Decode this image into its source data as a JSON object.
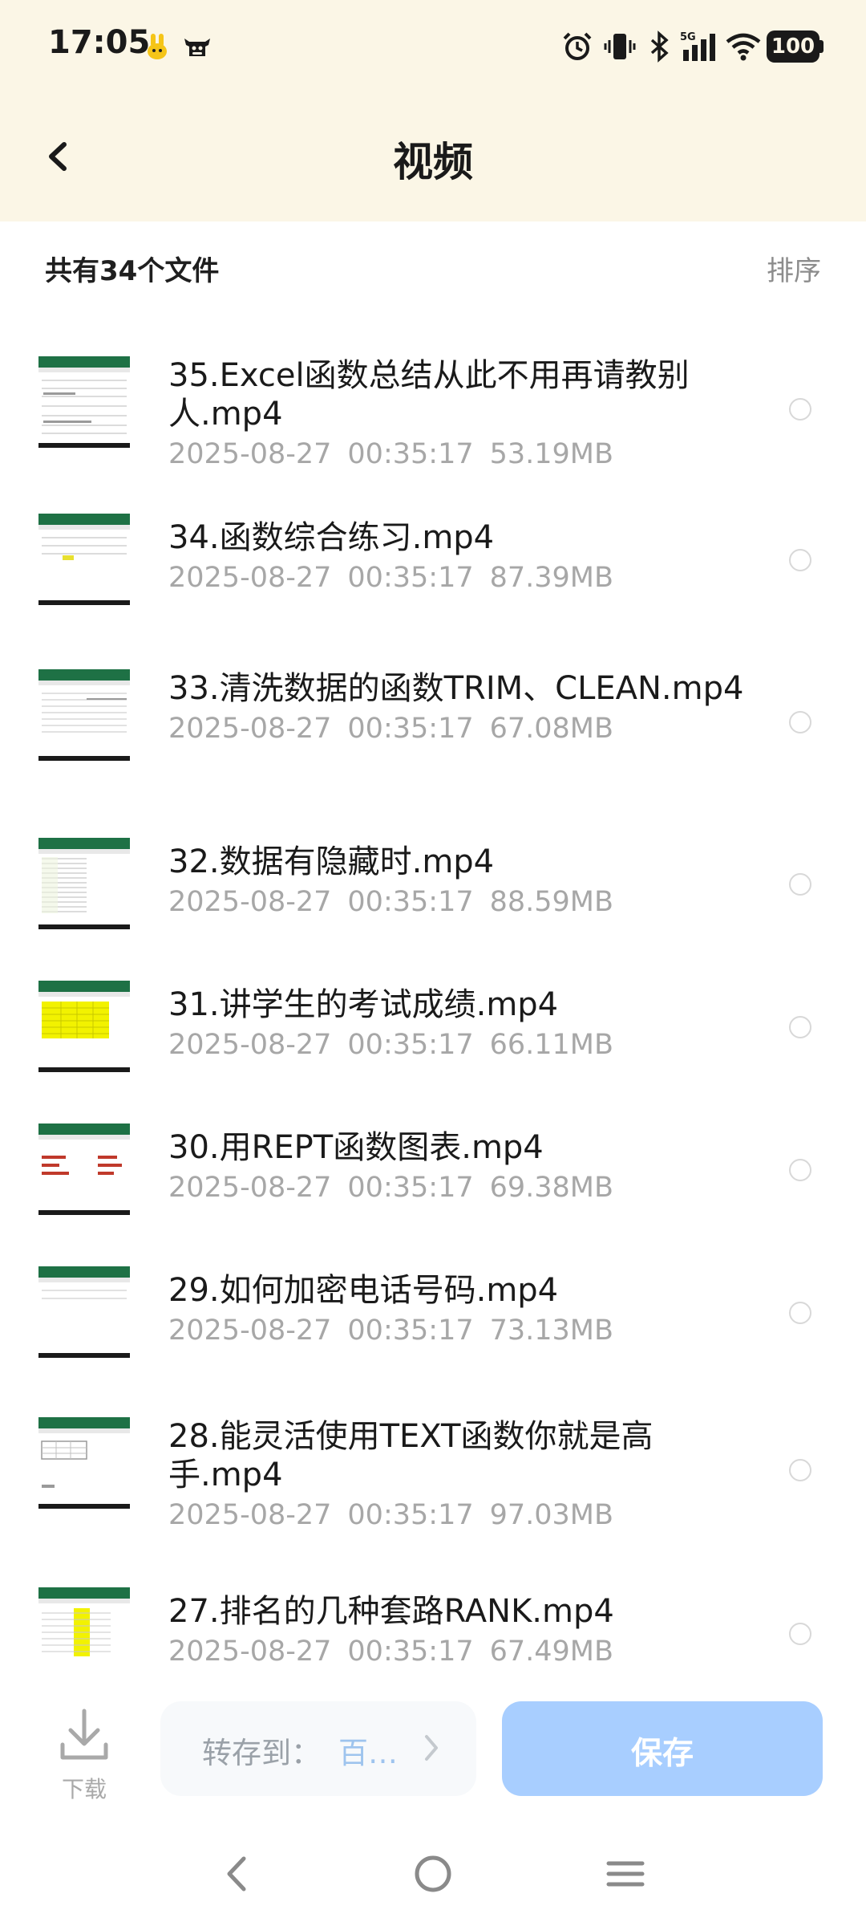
{
  "status_bar": {
    "time": "17:05",
    "network": "5G",
    "battery": "100"
  },
  "header": {
    "title": "视频"
  },
  "summary": {
    "count": "共有34个文件",
    "sort": "排序"
  },
  "files": [
    {
      "name": "35.Excel函数总结从此不用再请教别人.mp4",
      "date": "2025-08-27",
      "time": "00:35:17",
      "size": "53.19MB"
    },
    {
      "name": "34.函数综合练习.mp4",
      "date": "2025-08-27",
      "time": "00:35:17",
      "size": "87.39MB"
    },
    {
      "name": "33.清洗数据的函数TRIM、CLEAN.mp4",
      "date": "2025-08-27",
      "time": "00:35:17",
      "size": "67.08MB"
    },
    {
      "name": "32.数据有隐藏时.mp4",
      "date": "2025-08-27",
      "time": "00:35:17",
      "size": "88.59MB"
    },
    {
      "name": "31.讲学生的考试成绩.mp4",
      "date": "2025-08-27",
      "time": "00:35:17",
      "size": "66.11MB"
    },
    {
      "name": "30.用REPT函数图表.mp4",
      "date": "2025-08-27",
      "time": "00:35:17",
      "size": "69.38MB"
    },
    {
      "name": "29.如何加密电话号码.mp4",
      "date": "2025-08-27",
      "time": "00:35:17",
      "size": "73.13MB"
    },
    {
      "name": "28.能灵活使用TEXT函数你就是高手.mp4",
      "date": "2025-08-27",
      "time": "00:35:17",
      "size": "97.03MB"
    },
    {
      "name": "27.排名的几种套路RANK.mp4",
      "date": "2025-08-27",
      "time": "00:35:17",
      "size": "67.49MB"
    }
  ],
  "action_bar": {
    "download_label": "下载",
    "save_to_label": "转存到：",
    "save_to_target": "百…",
    "save_label": "保存"
  },
  "colors": {
    "header_bg": "#fbf6e6",
    "save_button": "#a8ceff",
    "meta_text": "#a7a7a7"
  }
}
